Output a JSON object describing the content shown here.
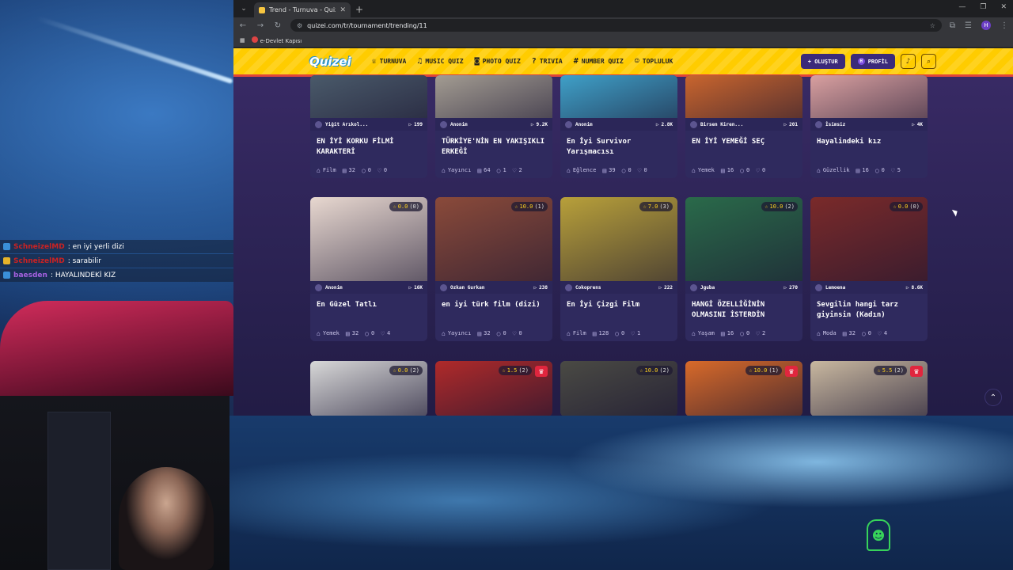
{
  "chat": [
    {
      "user": "SchneizelMD",
      "text": ": en iyi yerli dizi",
      "badge": "b1"
    },
    {
      "user": "SchneizelMD",
      "text": ": sarabilir",
      "badge": "b2"
    },
    {
      "user": "baesden",
      "text": ": HAYALINDEKİ KIZ",
      "badge": "b1"
    }
  ],
  "browser": {
    "tab_title": "Trend - Turnuva - Quizei",
    "url": "quizei.com/tr/tournament/trending/11",
    "bookmark": "e-Devlet Kapısı",
    "profile_initial": "H"
  },
  "site": {
    "logo": "Quizei",
    "nav": [
      {
        "label": "TURNUVA",
        "icon": "trophy-icon",
        "glyph": "♕"
      },
      {
        "label": "MUSIC QUIZ",
        "icon": "music-icon",
        "glyph": "♫"
      },
      {
        "label": "PHOTO QUIZ",
        "icon": "camera-icon",
        "glyph": "◙"
      },
      {
        "label": "TRIVIA",
        "icon": "question-icon",
        "glyph": "?"
      },
      {
        "label": "NUMBER QUIZ",
        "icon": "hash-icon",
        "glyph": "#"
      },
      {
        "label": "TOPLULUK",
        "icon": "community-icon",
        "glyph": "☺"
      }
    ],
    "create_label": "+ OLUŞTUR",
    "profile_label": "PROFİL",
    "profile_initial": "H"
  },
  "cards": [
    {
      "author": "Yiğit Arıkol...",
      "plays": "199",
      "title": "EN İYİ KORKU FİLMİ KARAKTERİ",
      "category": "Film",
      "questions": "32",
      "comments": "0",
      "likes": "0",
      "rating": "",
      "crown": false,
      "color": "#4a5a6a"
    },
    {
      "author": "Anonim",
      "plays": "9.2K",
      "title": "TÜRKİYE'NİN EN YAKIŞIKLI ERKEĞİ",
      "category": "Yayıncı",
      "questions": "64",
      "comments": "1",
      "likes": "2",
      "rating": "",
      "crown": false,
      "color": "#a39c92"
    },
    {
      "author": "Anonim",
      "plays": "2.8K",
      "title": "En İyi Survivor Yarışmacısı",
      "category": "Eğlence",
      "questions": "39",
      "comments": "0",
      "likes": "0",
      "rating": "",
      "crown": false,
      "color": "#3fa0c8"
    },
    {
      "author": "Birsen Kiren...",
      "plays": "201",
      "title": "EN İYİ YEMEĞİ SEÇ",
      "category": "Yemek",
      "questions": "16",
      "comments": "0",
      "likes": "0",
      "rating": "",
      "crown": false,
      "color": "#c9652e"
    },
    {
      "author": "İsimsiz",
      "plays": "4K",
      "title": "Hayalindeki kız",
      "category": "Güzellik",
      "questions": "16",
      "comments": "0",
      "likes": "5",
      "rating": "",
      "crown": false,
      "color": "#d9a0a0"
    },
    {
      "author": "Anonim",
      "plays": "16K",
      "title": "En Güzel Tatlı",
      "category": "Yemek",
      "questions": "32",
      "comments": "0",
      "likes": "4",
      "rating": "0.0",
      "rating_count": "(0)",
      "crown": false,
      "color": "#e8d8d0"
    },
    {
      "author": "Ozkan Gurkan",
      "plays": "238",
      "title": "en iyi türk film (dizi)",
      "category": "Yayıncı",
      "questions": "32",
      "comments": "0",
      "likes": "0",
      "rating": "10.0",
      "rating_count": "(1)",
      "crown": false,
      "color": "#8a4a3a"
    },
    {
      "author": "Cokoprens",
      "plays": "222",
      "title": "En İyi Çizgi Film",
      "category": "Film",
      "questions": "128",
      "comments": "0",
      "likes": "1",
      "rating": "7.0",
      "rating_count": "(3)",
      "crown": false,
      "color": "#b8a03a"
    },
    {
      "author": "Jguba",
      "plays": "270",
      "title": "HANGİ ÖZELLİĞİNİN OLMASINI İSTERDİN",
      "category": "Yaşam",
      "questions": "16",
      "comments": "0",
      "likes": "2",
      "rating": "10.0",
      "rating_count": "(2)",
      "crown": false,
      "color": "#2a6a4a"
    },
    {
      "author": "Lemoena",
      "plays": "8.6K",
      "title": "Sevgilin hangi tarz giyinsin (Kadın)",
      "category": "Moda",
      "questions": "32",
      "comments": "0",
      "likes": "4",
      "rating": "0.0",
      "rating_count": "(0)",
      "crown": false,
      "color": "#7a2a2a"
    },
    {
      "rating": "0.0",
      "rating_count": "(2)",
      "crown": false,
      "color": "#d8d8d8"
    },
    {
      "rating": "1.5",
      "rating_count": "(2)",
      "crown": true,
      "color": "#b02a2a"
    },
    {
      "rating": "10.0",
      "rating_count": "(2)",
      "crown": false,
      "color": "#4a4a44"
    },
    {
      "rating": "10.0",
      "rating_count": "(1)",
      "crown": true,
      "color": "#d86a2a"
    },
    {
      "rating": "5.5",
      "rating_count": "(2)",
      "crown": true,
      "color": "#c9b8a0"
    }
  ]
}
